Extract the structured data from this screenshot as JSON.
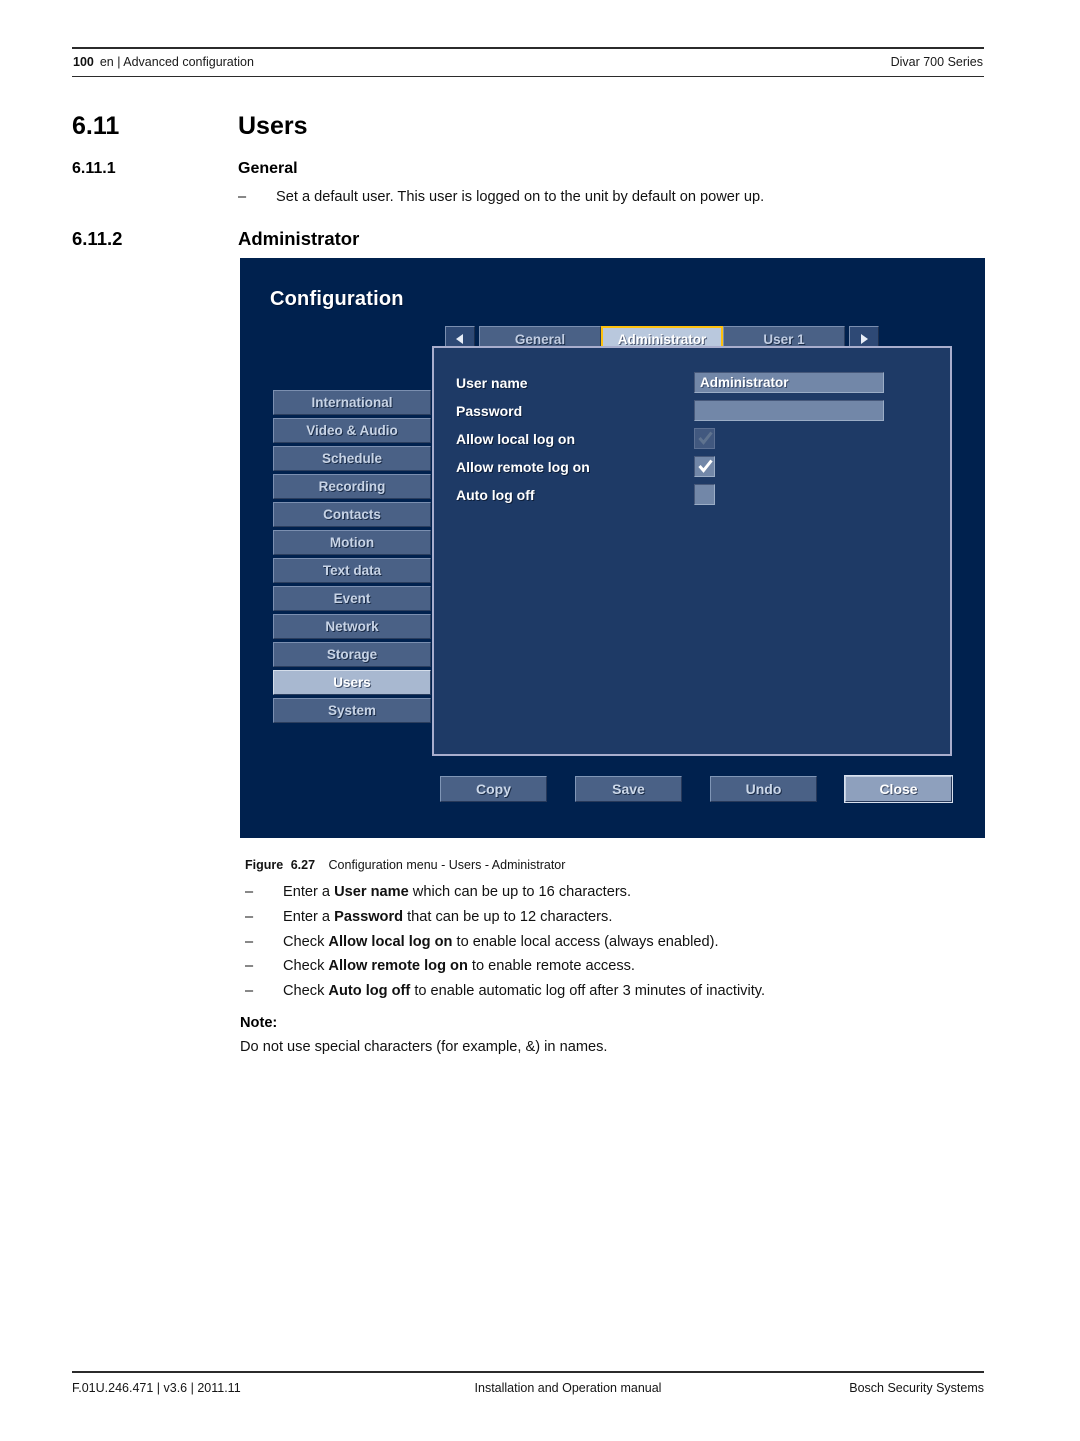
{
  "header": {
    "page_number": "100",
    "breadcrumb": "en | Advanced configuration",
    "product": "Divar 700 Series"
  },
  "sections": {
    "users": {
      "number": "6.11",
      "title": "Users"
    },
    "general": {
      "number": "6.11.1",
      "title": "General",
      "bullet": "Set a default user. This user is logged on to the unit by default on power up."
    },
    "administrator": {
      "number": "6.11.2",
      "title": "Administrator"
    }
  },
  "screenshot": {
    "title": "Configuration",
    "sidebar": [
      {
        "label": "International",
        "active": false
      },
      {
        "label": "Video & Audio",
        "active": false
      },
      {
        "label": "Schedule",
        "active": false
      },
      {
        "label": "Recording",
        "active": false
      },
      {
        "label": "Contacts",
        "active": false
      },
      {
        "label": "Motion",
        "active": false
      },
      {
        "label": "Text data",
        "active": false
      },
      {
        "label": "Event",
        "active": false
      },
      {
        "label": "Network",
        "active": false
      },
      {
        "label": "Storage",
        "active": false
      },
      {
        "label": "Users",
        "active": true
      },
      {
        "label": "System",
        "active": false
      }
    ],
    "tabs": {
      "prev_icon": "triangle-left-icon",
      "next_icon": "triangle-right-icon",
      "items": [
        {
          "label": "General",
          "selected": false
        },
        {
          "label": "Administrator",
          "selected": true
        },
        {
          "label": "User 1",
          "selected": false
        }
      ]
    },
    "fields": [
      {
        "label": "User name",
        "type": "text",
        "value": "Administrator"
      },
      {
        "label": "Password",
        "type": "text",
        "value": ""
      },
      {
        "label": "Allow local log on",
        "type": "checkbox",
        "checked": true,
        "disabled": true
      },
      {
        "label": "Allow remote log on",
        "type": "checkbox",
        "checked": true,
        "disabled": false
      },
      {
        "label": "Auto log off",
        "type": "checkbox",
        "checked": false,
        "disabled": false
      }
    ],
    "buttons": [
      {
        "label": "Copy",
        "focused": false
      },
      {
        "label": "Save",
        "focused": false
      },
      {
        "label": "Undo",
        "focused": false
      },
      {
        "label": "Close",
        "focused": true
      }
    ],
    "colors": {
      "panel_background": "#00214e",
      "dialog_background": "#1e3a66",
      "dialog_border": "#a9aecd",
      "button_face": "#4a6186",
      "active_item": "#a8b8d0",
      "field_face": "#7287a8",
      "selected_tab_outline": "#ffc20e"
    }
  },
  "figure": {
    "label": "Figure",
    "number": "6.27",
    "caption": "Configuration menu - Users - Administrator"
  },
  "bullets": [
    {
      "pre": "Enter a ",
      "bold": "User name",
      "post": " which can be up to 16 characters."
    },
    {
      "pre": "Enter a ",
      "bold": "Password",
      "post": " that can be up to 12 characters."
    },
    {
      "pre": "Check ",
      "bold": "Allow local log on",
      "post": " to enable local access (always enabled)."
    },
    {
      "pre": "Check ",
      "bold": "Allow remote log on",
      "post": " to enable remote access."
    },
    {
      "pre": "Check ",
      "bold": "Auto log off",
      "post": " to enable automatic log off after 3 minutes of inactivity."
    }
  ],
  "note": {
    "heading": "Note:",
    "body": "Do not use special characters (for example, &) in names."
  },
  "footer": {
    "left": "F.01U.246.471 | v3.6 | 2011.11",
    "center": "Installation and Operation manual",
    "right": "Bosch Security Systems"
  }
}
